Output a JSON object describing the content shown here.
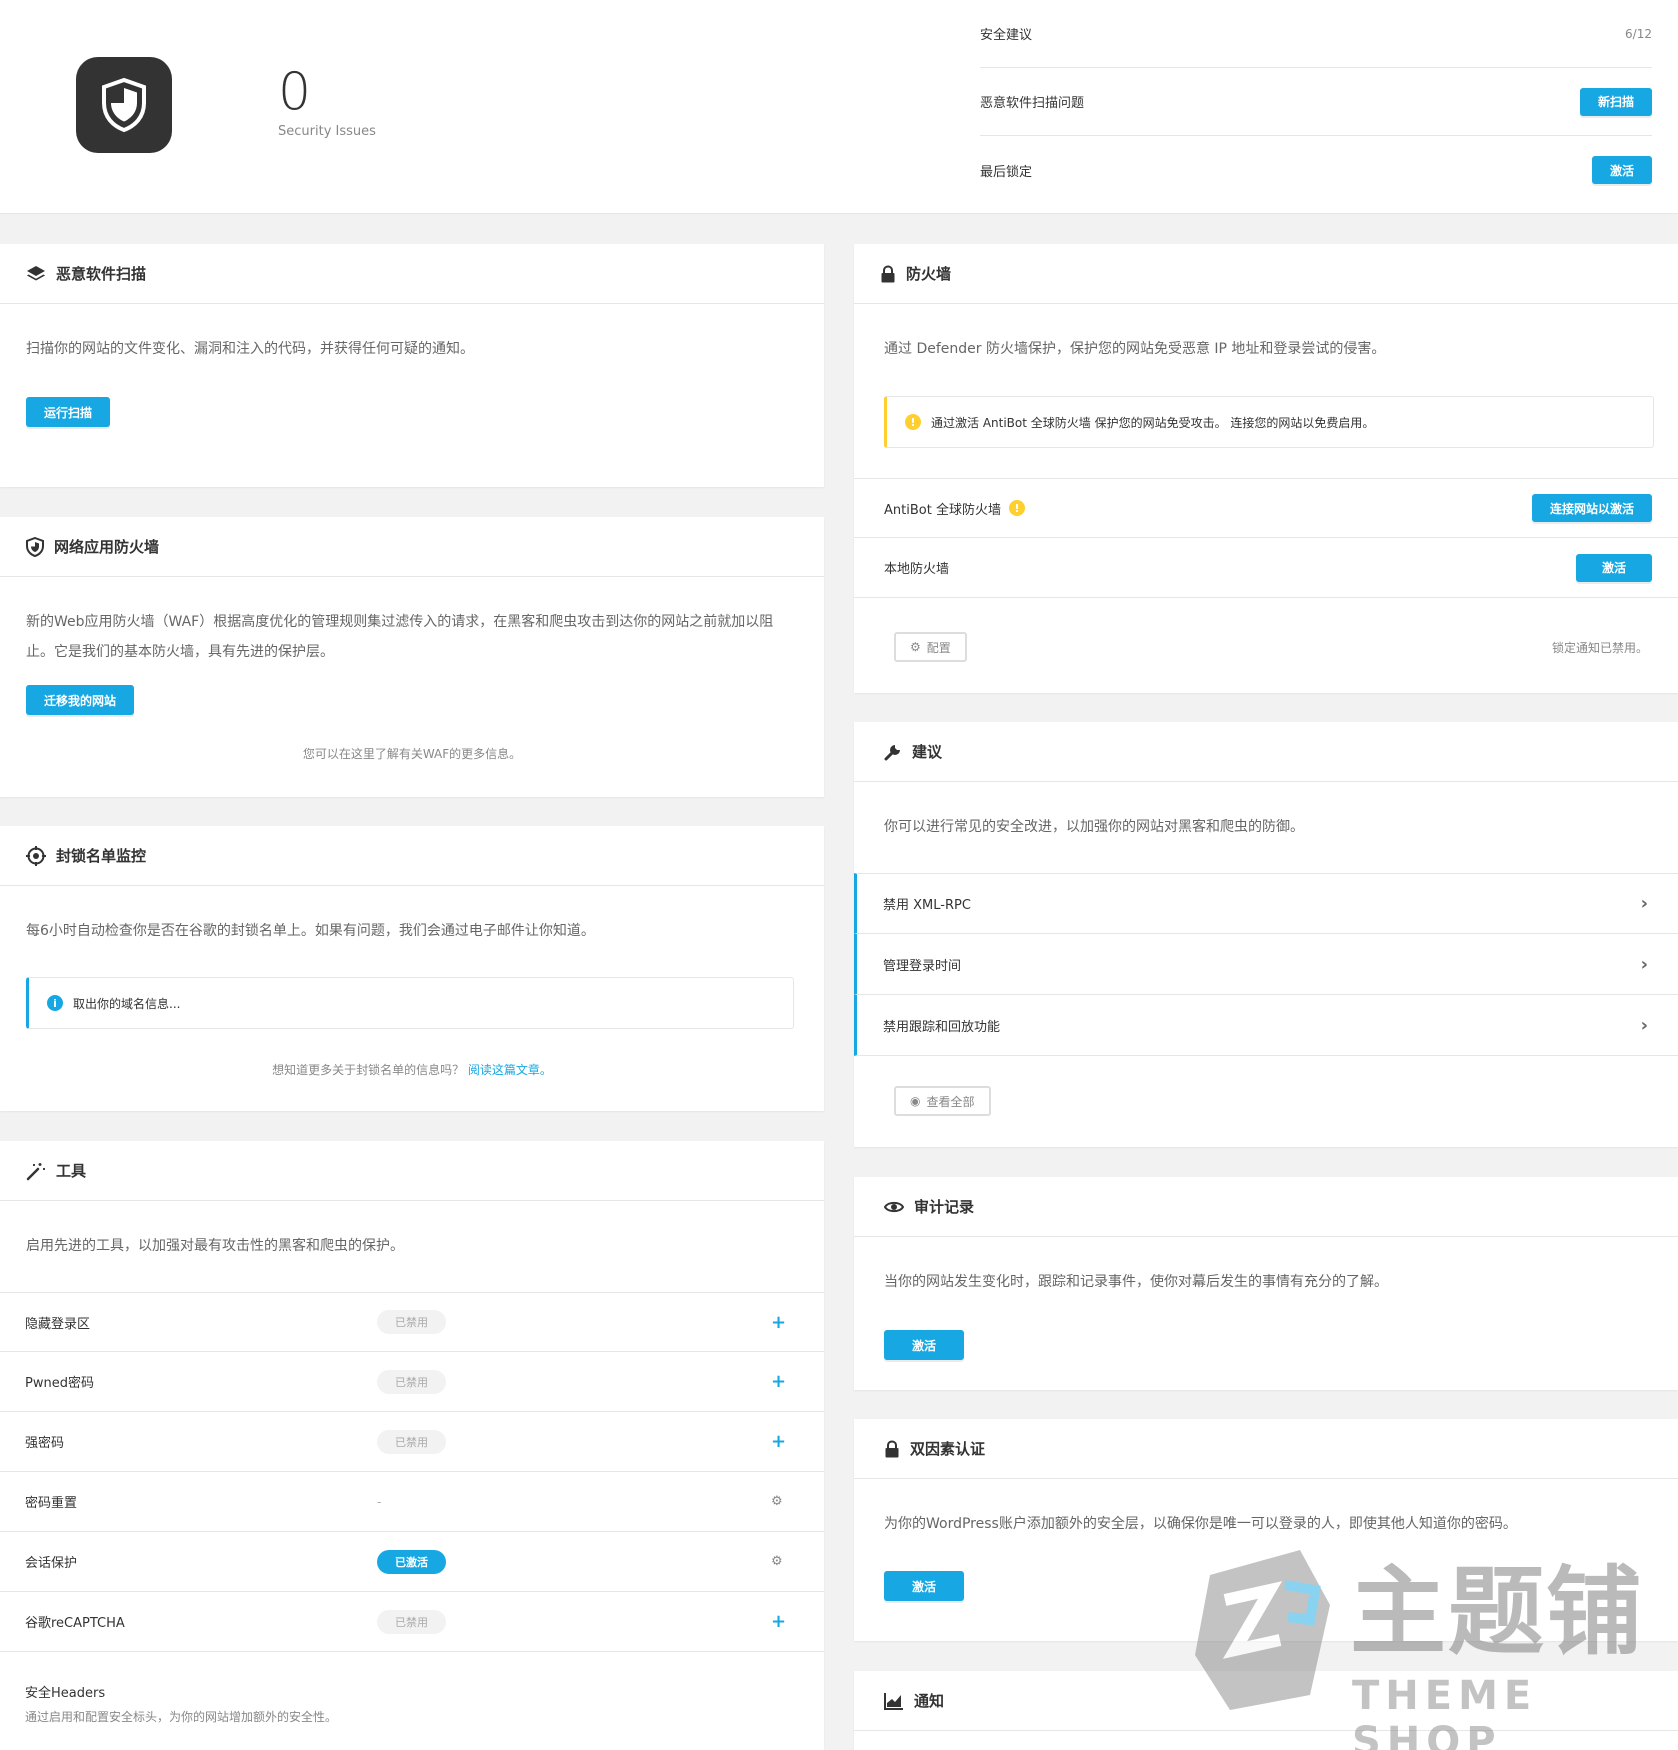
{
  "summary": {
    "issue_count": "0",
    "issue_label": "Security Issues",
    "rows": [
      {
        "label": "安全建议",
        "value": "6/12"
      },
      {
        "label": "恶意软件扫描问题",
        "button": "新扫描"
      },
      {
        "label": "最后锁定",
        "button": "激活"
      }
    ]
  },
  "malware": {
    "title": "恶意软件扫描",
    "description": "扫描你的网站的文件变化、漏洞和注入的代码，并获得任何可疑的通知。",
    "button": "运行扫描"
  },
  "waf": {
    "title": "网络应用防火墙",
    "description": "新的Web应用防火墙（WAF）根据高度优化的管理规则集过滤传入的请求，在黑客和爬虫攻击到达你的网站之前就加以阻止。它是我们的基本防火墙，具有先进的保护层。",
    "button": "迁移我的网站",
    "footnote": "您可以在这里了解有关WAF的更多信息。"
  },
  "blocklist": {
    "title": "封锁名单监控",
    "description": "每6小时自动检查你是否在谷歌的封锁名单上。如果有问题，我们会通过电子邮件让你知道。",
    "notice": "取出你的域名信息...",
    "footnote": "想知道更多关于封锁名单的信息吗？",
    "link": "阅读这篇文章。"
  },
  "tools": {
    "title": "工具",
    "description": "启用先进的工具，以加强对最有攻击性的黑客和爬虫的保护。",
    "items": [
      {
        "name": "隐藏登录区",
        "status": "已禁用",
        "action": "+"
      },
      {
        "name": "Pwned密码",
        "status": "已禁用",
        "action": "+"
      },
      {
        "name": "强密码",
        "status": "已禁用",
        "action": "+"
      },
      {
        "name": "密码重置",
        "status": "-",
        "action": "⚙"
      },
      {
        "name": "会话保护",
        "status": "已激活",
        "action": "⚙"
      },
      {
        "name": "谷歌reCAPTCHA",
        "status": "已禁用",
        "action": "+"
      }
    ],
    "headers_title": "安全Headers",
    "headers_desc": "通过启用和配置安全标头，为你的网站增加额外的安全性。"
  },
  "firewall": {
    "title": "防火墙",
    "description": "通过 Defender 防火墙保护，保护您的网站免受恶意 IP 地址和登录尝试的侵害。",
    "notice": "通过激活 AntiBot 全球防火墙 保护您的网站免受攻击。 连接您的网站以免费启用。",
    "antibot_label": "AntiBot 全球防火墙",
    "antibot_button": "连接网站以激活",
    "local_label": "本地防火墙",
    "local_button": "激活",
    "config_button": "配置",
    "lockout_note": "锁定通知已禁用。"
  },
  "recommendations": {
    "title": "建议",
    "description": "你可以进行常见的安全改进，以加强你的网站对黑客和爬虫的防御。",
    "items": [
      "禁用 XML-RPC",
      "管理登录时间",
      "禁用跟踪和回放功能"
    ],
    "view_all": "查看全部"
  },
  "audit": {
    "title": "审计记录",
    "description": "当你的网站发生变化时，跟踪和记录事件，使你对幕后发生的事情有充分的了解。",
    "button": "激活"
  },
  "twofa": {
    "title": "双因素认证",
    "description": "为你的WordPress账户添加额外的安全层，以确保你是唯一可以登录的人，即使其他人知道你的密码。",
    "button": "激活"
  },
  "notifications": {
    "title": "通知"
  },
  "watermark": {
    "cn": "主题铺",
    "en": "THEME SHOP"
  },
  "colors": {
    "accent": "#17a8e3",
    "warning": "#fecf2f",
    "dark": "#333333"
  }
}
